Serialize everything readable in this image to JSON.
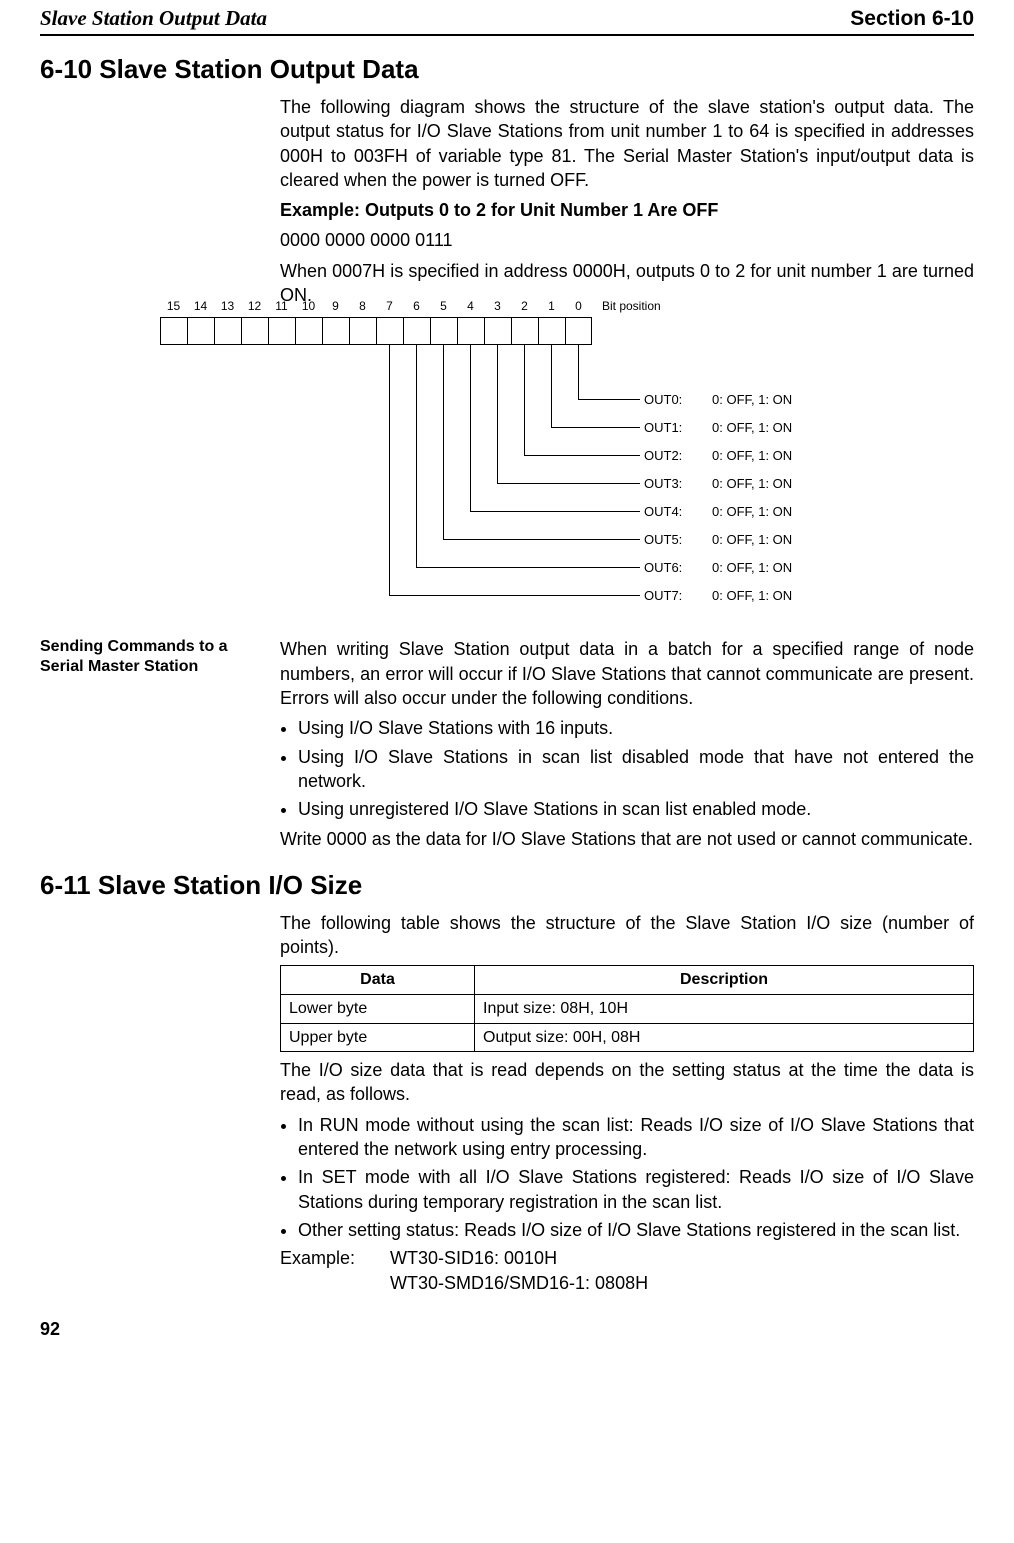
{
  "header": {
    "left": "Slave Station Output Data",
    "right": "Section 6-10"
  },
  "section_610": {
    "title": "6-10   Slave Station Output Data",
    "p1": "The following diagram shows the structure of the slave station's output data. The output status for I/O Slave Stations from unit number 1 to 64 is specified in addresses 000H to 003FH of variable type 81. The Serial Master Station's input/output data is cleared when the power is turned OFF.",
    "example_title": "Example: Outputs 0 to 2 for Unit Number 1 Are OFF",
    "example_line1": "0000 0000 0000 0111",
    "example_line2": "When 0007H is specified in address 0000H, outputs 0 to 2 for unit number 1 are turned ON.",
    "bit_labels": [
      "15",
      "14",
      "13",
      "12",
      "11",
      "10",
      "9",
      "8",
      "7",
      "6",
      "5",
      "4",
      "3",
      "2",
      "1",
      "0"
    ],
    "bit_position_label": "Bit position",
    "outs": [
      {
        "name": "OUT0:",
        "val": "0: OFF, 1: ON"
      },
      {
        "name": "OUT1:",
        "val": "0: OFF, 1: ON"
      },
      {
        "name": "OUT2:",
        "val": "0: OFF, 1: ON"
      },
      {
        "name": "OUT3:",
        "val": "0: OFF, 1: ON"
      },
      {
        "name": "OUT4:",
        "val": "0: OFF, 1: ON"
      },
      {
        "name": "OUT5:",
        "val": "0: OFF, 1: ON"
      },
      {
        "name": "OUT6:",
        "val": "0: OFF, 1: ON"
      },
      {
        "name": "OUT7:",
        "val": "0: OFF, 1: ON"
      }
    ],
    "sending_label_l1": "Sending Commands to a",
    "sending_label_l2": "Serial Master Station",
    "sending_p": "When writing Slave Station output data in a batch for a specified range of node numbers, an error will occur if I/O Slave Stations that cannot communicate are present. Errors will also occur under the following conditions.",
    "sending_bullets": [
      "Using I/O Slave Stations with 16 inputs.",
      "Using I/O Slave Stations in scan list disabled mode that have not entered the network.",
      "Using unregistered I/O Slave Stations in scan list enabled mode."
    ],
    "sending_after": "Write 0000 as the data for I/O Slave Stations that are not used or cannot communicate."
  },
  "section_611": {
    "title": "6-11   Slave Station I/O Size",
    "p1": "The following table shows the structure of the Slave Station I/O size (number of points).",
    "table": {
      "head": [
        "Data",
        "Description"
      ],
      "rows": [
        [
          "Lower byte",
          "Input size: 08H, 10H"
        ],
        [
          "Upper byte",
          "Output size: 00H, 08H"
        ]
      ]
    },
    "p2": "The I/O size data that is read depends on the setting status at the time the data is read, as follows.",
    "bullets": [
      "In RUN mode without using the scan list: Reads I/O size of I/O Slave Stations that entered the network using entry processing.",
      "In SET mode with all I/O Slave Stations registered: Reads I/O size of I/O Slave Stations during temporary registration in the scan list.",
      "Other setting status: Reads I/O size of I/O Slave Stations registered in the scan list."
    ],
    "example_label": "Example:",
    "example_v1": "WT30-SID16: 0010H",
    "example_v2": "WT30-SMD16/SMD16-1: 0808H"
  },
  "page_number": "92"
}
